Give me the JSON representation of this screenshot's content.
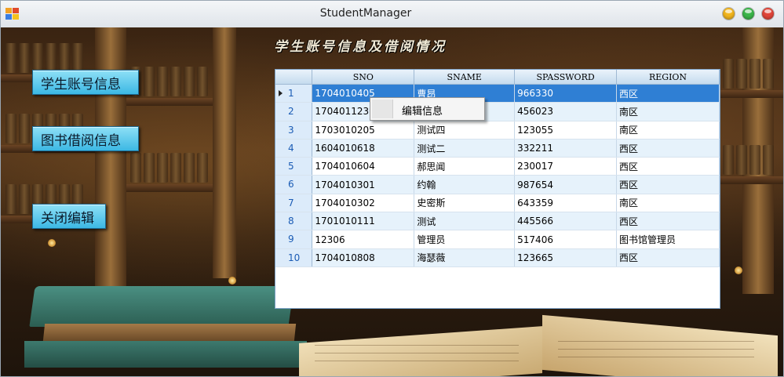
{
  "window": {
    "title": "StudentManager",
    "controls": {
      "minimize_color": "#f2b51e",
      "maximize_color": "#3cb64a",
      "close_color": "#e2463a"
    }
  },
  "banner": {
    "text": "学生账号信息及借阅情况"
  },
  "nav": {
    "student_accounts": "学生账号信息",
    "book_borrowing": "图书借阅信息",
    "close_edit": "关闭编辑"
  },
  "grid": {
    "columns": [
      "SNO",
      "SNAME",
      "SPASSWORD",
      "REGION"
    ],
    "selected_row": 1,
    "rows": [
      {
        "n": "1",
        "sno": "1704010405",
        "sname": "曹昂",
        "spassword": "966330",
        "region": "西区"
      },
      {
        "n": "2",
        "sno": "1704011230",
        "sname": "",
        "spassword": "456023",
        "region": "南区"
      },
      {
        "n": "3",
        "sno": "1703010205",
        "sname": "测试四",
        "spassword": "123055",
        "region": "南区"
      },
      {
        "n": "4",
        "sno": "1604010618",
        "sname": "测试二",
        "spassword": "332211",
        "region": "西区"
      },
      {
        "n": "5",
        "sno": "1704010604",
        "sname": "郝思闻",
        "spassword": "230017",
        "region": "西区"
      },
      {
        "n": "6",
        "sno": "1704010301",
        "sname": "约翰",
        "spassword": "987654",
        "region": "西区"
      },
      {
        "n": "7",
        "sno": "1704010302",
        "sname": "史密斯",
        "spassword": "643359",
        "region": "南区"
      },
      {
        "n": "8",
        "sno": "1701010111",
        "sname": "测试",
        "spassword": "445566",
        "region": "西区"
      },
      {
        "n": "9",
        "sno": "12306",
        "sname": "管理员",
        "spassword": "517406",
        "region": "图书馆管理员"
      },
      {
        "n": "10",
        "sno": "1704010808",
        "sname": "海瑟薇",
        "spassword": "123665",
        "region": "西区"
      }
    ]
  },
  "context_menu": {
    "items": [
      "编辑信息"
    ]
  },
  "colors": {
    "selection": "#2f7fd4",
    "button_face": "#3cb8e4",
    "grid_alt_row": "#e6f2fb"
  }
}
